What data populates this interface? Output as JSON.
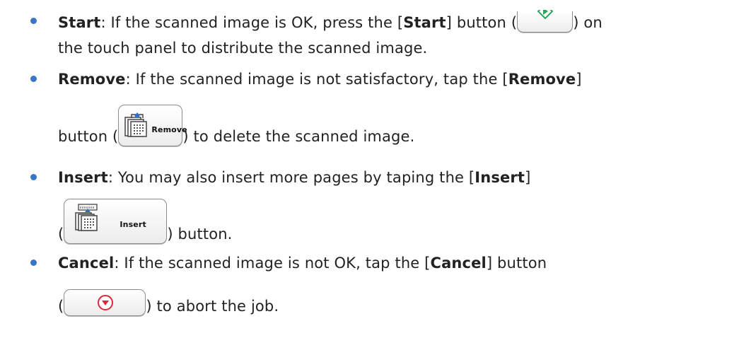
{
  "items": [
    {
      "term": "Start",
      "line1_before": ": If the scanned image is OK, press the [",
      "line1_term": "Start",
      "line1_after": "] button (",
      "line1_end": ") on",
      "line2": "the touch panel to distribute the scanned image.",
      "icon": "start-diamond-icon",
      "accent": "#2aa55a"
    },
    {
      "term": "Remove",
      "line1_before": ": If the scanned image is not satisfactory, tap the [",
      "line1_term": "Remove",
      "line1_after": "]",
      "line2_before": "button (",
      "line2_after": ") to delete the scanned image.",
      "button_caption": "Remove",
      "icon": "remove-pages-icon"
    },
    {
      "term": "Insert",
      "line1_before": ": You may also insert more pages by taping the [",
      "line1_term": "Insert",
      "line1_after": "]",
      "line2_before": "(",
      "line2_after": ") button.",
      "button_caption": "Insert",
      "icon": "insert-pages-icon"
    },
    {
      "term": "Cancel",
      "line1_before": ": If the scanned image is not OK, tap the [",
      "line1_term": "Cancel",
      "line1_after": "] button",
      "line2_before": "(",
      "line2_after": ") to abort the job.",
      "icon": "cancel-circle-icon",
      "accent": "#e0263a"
    }
  ],
  "colors": {
    "bullet": "#3a74c4",
    "text": "#222222"
  }
}
